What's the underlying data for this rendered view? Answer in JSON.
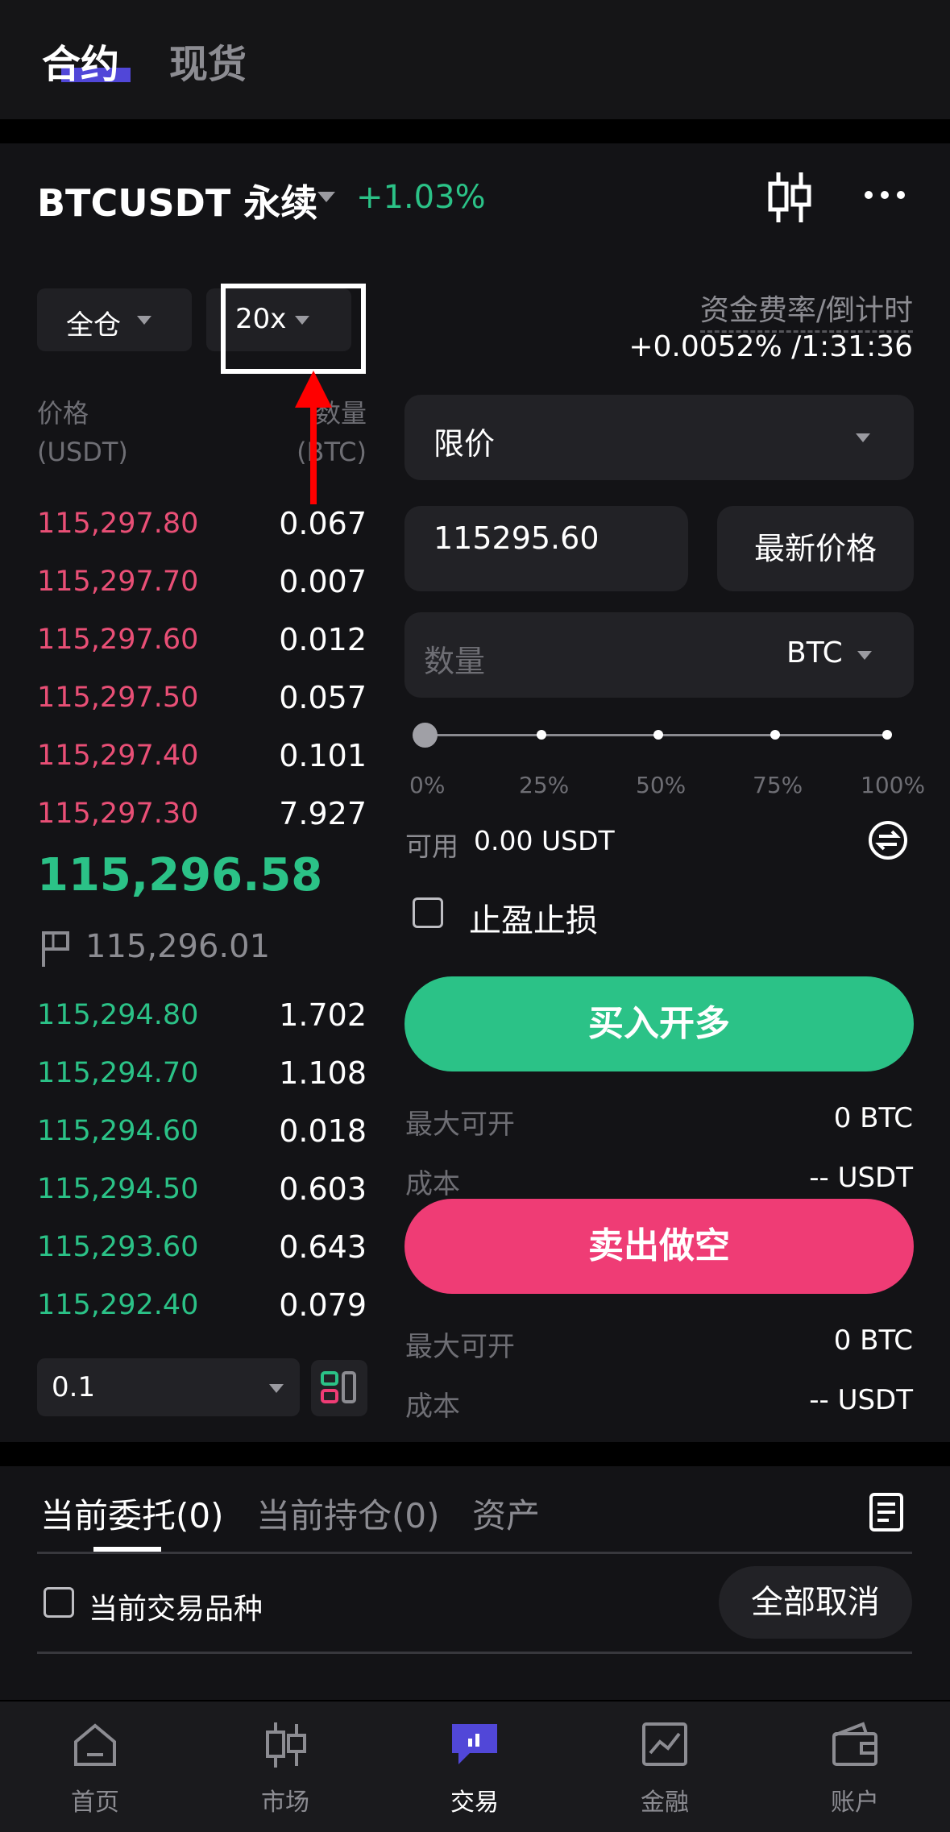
{
  "top_tabs": {
    "futures": "合约",
    "spot": "现货"
  },
  "header": {
    "symbol": "BTCUSDT 永续",
    "change": "+1.03%"
  },
  "margin": {
    "mode": "全仓",
    "leverage": "20x"
  },
  "orderbook": {
    "price_header": "价格",
    "price_unit": "(USDT)",
    "qty_header": "数量",
    "qty_unit": "(BTC)",
    "asks": [
      {
        "price": "115,297.80",
        "qty": "0.067"
      },
      {
        "price": "115,297.70",
        "qty": "0.007"
      },
      {
        "price": "115,297.60",
        "qty": "0.012"
      },
      {
        "price": "115,297.50",
        "qty": "0.057"
      },
      {
        "price": "115,297.40",
        "qty": "0.101"
      },
      {
        "price": "115,297.30",
        "qty": "7.927"
      }
    ],
    "last_price": "115,296.58",
    "mark_price": "115,296.01",
    "bids": [
      {
        "price": "115,294.80",
        "qty": "1.702"
      },
      {
        "price": "115,294.70",
        "qty": "1.108"
      },
      {
        "price": "115,294.60",
        "qty": "0.018"
      },
      {
        "price": "115,294.50",
        "qty": "0.603"
      },
      {
        "price": "115,293.60",
        "qty": "0.643"
      },
      {
        "price": "115,292.40",
        "qty": "0.079"
      }
    ],
    "depth": "0.1"
  },
  "funding": {
    "label": "资金费率/倒计时",
    "value": "+0.0052% /1:31:36"
  },
  "order_form": {
    "order_type": "限价",
    "price": "115295.60",
    "latest_price_btn": "最新价格",
    "qty_placeholder": "数量",
    "qty_unit": "BTC",
    "slider_value": 0,
    "slider_marks": [
      "0%",
      "25%",
      "50%",
      "75%",
      "100%"
    ],
    "available_label": "可用",
    "available_value": "0.00 USDT",
    "tp_sl_label": "止盈止损",
    "buy_btn": "买入开多",
    "sell_btn": "卖出做空",
    "buy_max_label": "最大可开",
    "buy_max_value": "0 BTC",
    "buy_cost_label": "成本",
    "buy_cost_value": "-- USDT",
    "sell_max_label": "最大可开",
    "sell_max_value": "0 BTC",
    "sell_cost_label": "成本",
    "sell_cost_value": "-- USDT"
  },
  "orders": {
    "tabs": [
      "当前委托(0)",
      "当前持仓(0)",
      "资产"
    ],
    "current_symbol_label": "当前交易品种",
    "cancel_all": "全部取消"
  },
  "nav": [
    "首页",
    "市场",
    "交易",
    "金融",
    "账户"
  ],
  "colors": {
    "green": "#2bc287",
    "red": "#ef3c75",
    "accent": "#5147d8",
    "annotation": "#ff0000"
  }
}
